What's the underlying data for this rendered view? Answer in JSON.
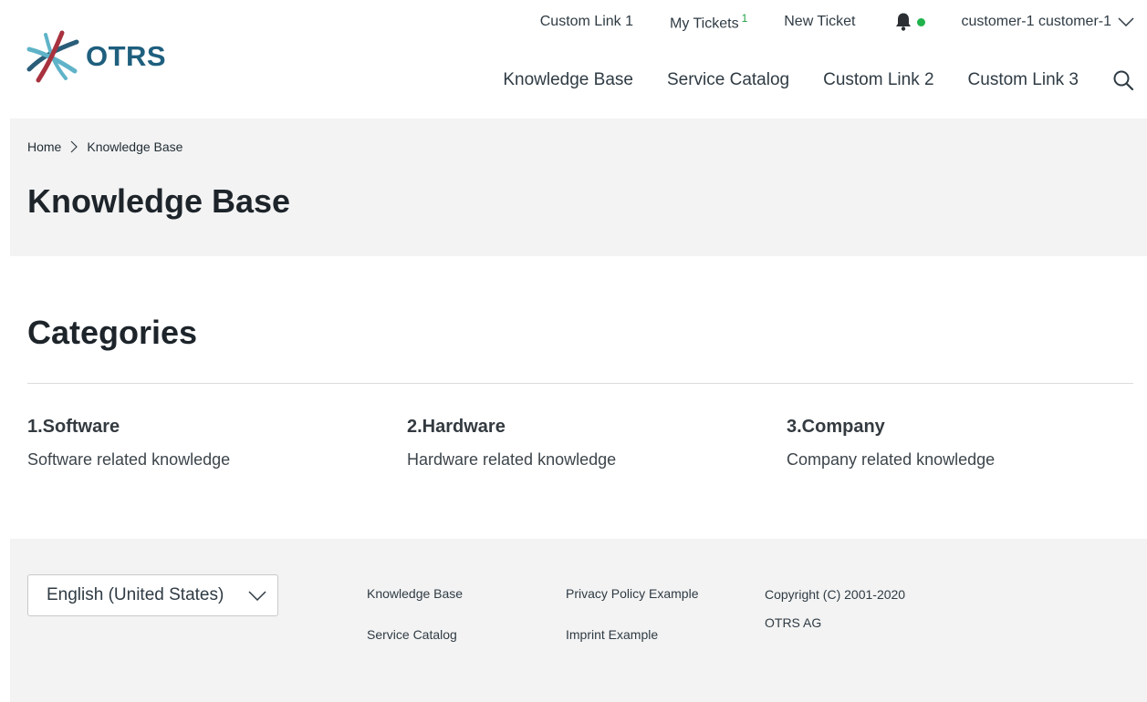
{
  "brand": {
    "logo_text": "OTRS",
    "colors": {
      "teal": "#5fb3c8",
      "red": "#a8323e",
      "dark": "#1f5f7e",
      "accent_green": "#21b24b"
    }
  },
  "top_nav": {
    "custom_link_1": "Custom Link 1",
    "my_tickets": "My Tickets",
    "my_tickets_count": "1",
    "new_ticket": "New Ticket",
    "notification_icon": "bell-icon",
    "user": "customer-1 customer-1"
  },
  "main_nav": {
    "items": [
      "Knowledge Base",
      "Service Catalog",
      "Custom Link 2",
      "Custom Link 3"
    ],
    "search_icon": "search-icon"
  },
  "breadcrumb": {
    "home": "Home",
    "current": "Knowledge Base"
  },
  "page_title": "Knowledge Base",
  "categories": {
    "title": "Categories",
    "items": [
      {
        "title": "1.Software",
        "description": "Software related knowledge"
      },
      {
        "title": "2.Hardware",
        "description": "Hardware related knowledge"
      },
      {
        "title": "3.Company",
        "description": "Company related knowledge"
      }
    ]
  },
  "footer": {
    "language": "English (United States)",
    "links": [
      "Knowledge Base",
      "Service Catalog",
      "Privacy Policy Example",
      "Imprint Example"
    ],
    "copyright_line1": "Copyright (C) 2001-2020",
    "copyright_line2": "OTRS AG"
  }
}
